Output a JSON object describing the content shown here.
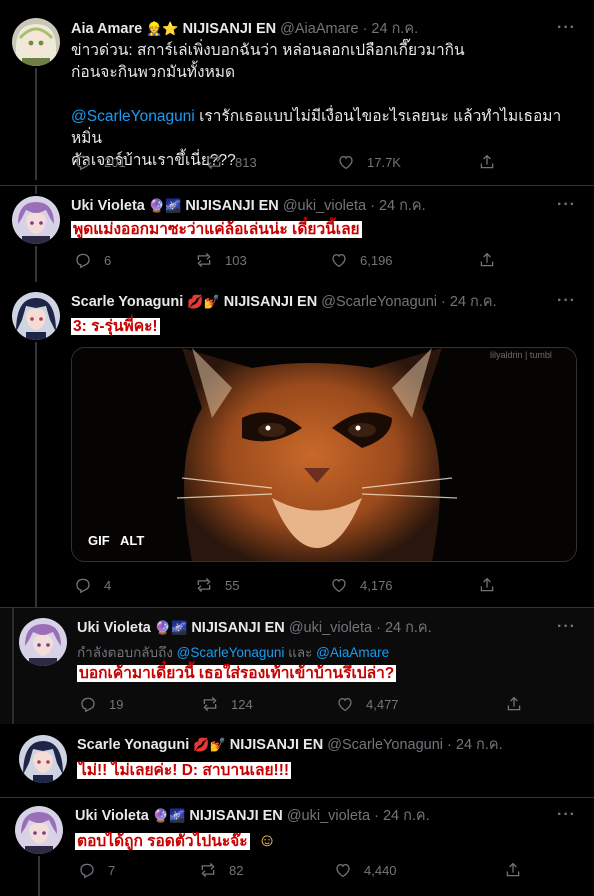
{
  "tweets": [
    {
      "name": "Aia Amare",
      "emoji": "👷⭐",
      "affiliation": "NIJISANJI EN",
      "handle": "@AiaAmare",
      "date": "· 24 ก.ค.",
      "text1": "ข่าวด่วน: สการ์เล่เพิ่งบอกฉันว่า หล่อนลอกเปลือกเกี๊ยวมากิน",
      "text2": "ก่อนจะกินพวกมันทั้งหมด",
      "mention": "@ScarleYonaguni",
      "text3": " เรารักเธอแบบไม่มีเงื่อนไขอะไรเลยนะ แล้วทำไมเธอมาหมิ่น",
      "text4": "คัลเจอร์บ้านเราขึ้เนี่ย???",
      "replies": "201",
      "retweets": "813",
      "likes": "17.7K"
    },
    {
      "name": "Uki Violeta",
      "emoji": "🔮🌌",
      "affiliation": "NIJISANJI EN",
      "handle": "@uki_violeta",
      "date": "· 24 ก.ค.",
      "text": "พูดแม่งออกมาซะว่าแค่ล้อเล่นน่ะ เดี๋ยวนี้เลย",
      "replies": "6",
      "retweets": "103",
      "likes": "6,196"
    },
    {
      "name": "Scarle Yonaguni",
      "emoji": "💋💅",
      "affiliation": "NIJISANJI EN",
      "handle": "@ScarleYonaguni",
      "date": "· 24 ก.ค.",
      "text": "3: ร-รุ่นพี่คะ!",
      "media_watermark": "lilyaldrin | tumbl",
      "gif_label": "GIF",
      "alt_label": "ALT",
      "replies": "4",
      "retweets": "55",
      "likes": "4,176"
    },
    {
      "name": "Uki Violeta",
      "emoji": "🔮🌌",
      "affiliation": "NIJISANJI EN",
      "handle": "@uki_violeta",
      "date": "· 24 ก.ค.",
      "reply_prefix": "กำลังตอบกลับถึง ",
      "reply_to1": "@ScarleYonaguni",
      "reply_and": " และ ",
      "reply_to2": "@AiaAmare",
      "text": "บอกเค้ามาเดี๋ยวนี้ เธอใส่รองเท้าเข้าบ้านรึเปล่า?",
      "replies": "19",
      "retweets": "124",
      "likes": "4,477"
    },
    {
      "name": "Scarle Yonaguni",
      "emoji": "💋💅",
      "affiliation": "NIJISANJI EN",
      "handle": "@ScarleYonaguni",
      "date": "· 24 ก.ค.",
      "text": "ไม่!! ไม่เลยค่ะ! D: สาบานเลย!!!"
    },
    {
      "name": "Uki Violeta",
      "emoji": "🔮🌌",
      "affiliation": "NIJISANJI EN",
      "handle": "@uki_violeta",
      "date": "· 24 ก.ค.",
      "text": "ตอบได้ถูก รอดตัวไปนะจ๊ะ",
      "text_emoji": "☺",
      "replies": "7",
      "retweets": "82",
      "likes": "4,440"
    }
  ],
  "more_label": "···",
  "colors": {
    "accent": "#1d9bf0",
    "highlight_text": "#c80000"
  }
}
